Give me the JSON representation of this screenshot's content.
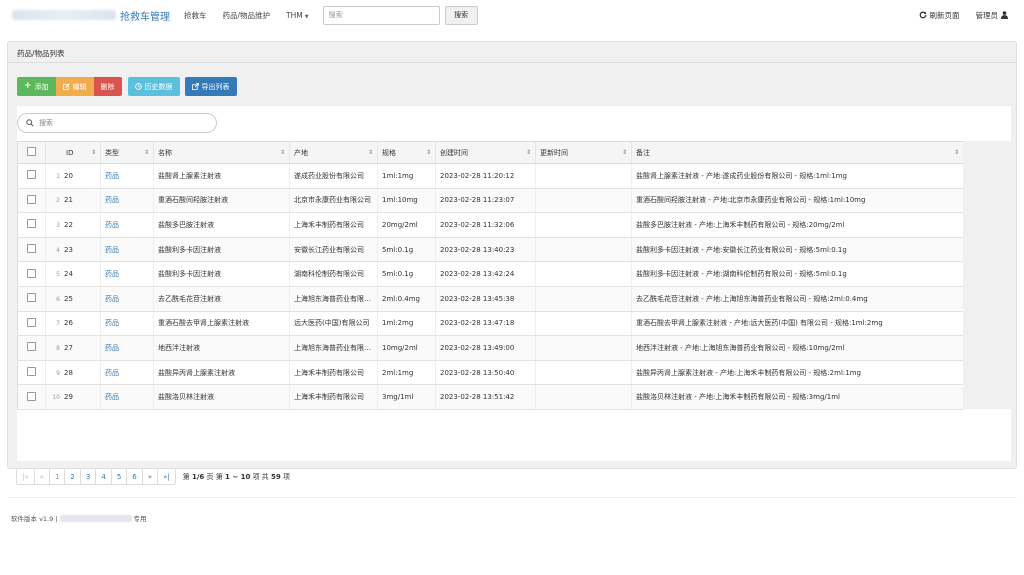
{
  "navbar": {
    "brand": "抢救车管理",
    "links": [
      "抢救车",
      "药品/物品维护",
      "THM"
    ],
    "search_placeholder": "搜索",
    "search_button": "搜索",
    "refresh": "刷新页面",
    "user": "管理员"
  },
  "panel": {
    "title": "药品/物品列表",
    "toolbar": {
      "add": "添加",
      "edit": "编辑",
      "delete": "删除",
      "history": "历史数据",
      "export": "导出列表"
    },
    "search_placeholder": "搜索"
  },
  "table": {
    "columns": [
      "ID",
      "类型",
      "名称",
      "产地",
      "规格",
      "创建时间",
      "更新时间",
      "备注"
    ],
    "rows": [
      {
        "n": "1",
        "id": "20",
        "type": "药品",
        "name": "盐酸肾上腺素注射液",
        "origin": "遂成药业股份有限公司",
        "spec": "1ml:1mg",
        "created": "2023-02-28 11:20:12",
        "updated": "",
        "note": "盐酸肾上腺素注射液 - 产地:遂成药业股份有限公司 - 规格:1ml:1mg"
      },
      {
        "n": "2",
        "id": "21",
        "type": "药品",
        "name": "重酒石酸间羟胺注射液",
        "origin": "北京市永康药业有限公司",
        "spec": "1ml:10mg",
        "created": "2023-02-28 11:23:07",
        "updated": "",
        "note": "重酒石酸间羟胺注射液 - 产地:北京市永康药业有限公司 - 规格:1ml:10mg"
      },
      {
        "n": "3",
        "id": "22",
        "type": "药品",
        "name": "盐酸多巴胺注射液",
        "origin": "上海禾丰制药有限公司",
        "spec": "20mg/2ml",
        "created": "2023-02-28 11:32:06",
        "updated": "",
        "note": "盐酸多巴胺注射液 - 产地:上海禾丰制药有限公司 - 规格:20mg/2ml"
      },
      {
        "n": "4",
        "id": "23",
        "type": "药品",
        "name": "盐酸利多卡因注射液",
        "origin": "安徽长江药业有限公司",
        "spec": "5ml:0.1g",
        "created": "2023-02-28 13:40:23",
        "updated": "",
        "note": "盐酸利多卡因注射液 - 产地:安徽长江药业有限公司 - 规格:5ml:0.1g"
      },
      {
        "n": "5",
        "id": "24",
        "type": "药品",
        "name": "盐酸利多卡因注射液",
        "origin": "湖南科伦制药有限公司",
        "spec": "5ml:0.1g",
        "created": "2023-02-28 13:42:24",
        "updated": "",
        "note": "盐酸利多卡因注射液 - 产地:湖南科伦制药有限公司 - 规格:5ml:0.1g"
      },
      {
        "n": "6",
        "id": "25",
        "type": "药品",
        "name": "去乙酰毛花苷注射液",
        "origin": "上海旭东海普药业有限公司",
        "spec": "2ml:0.4mg",
        "created": "2023-02-28 13:45:38",
        "updated": "",
        "note": "去乙酰毛花苷注射液 - 产地:上海旭东海普药业有限公司 - 规格:2ml:0.4mg"
      },
      {
        "n": "7",
        "id": "26",
        "type": "药品",
        "name": "重酒石酸去甲肾上腺素注射液",
        "origin": "远大医药(中国)有限公司",
        "spec": "1ml:2mg",
        "created": "2023-02-28 13:47:18",
        "updated": "",
        "note": "重酒石酸去甲肾上腺素注射液 - 产地:远大医药(中国) 有限公司 - 规格:1ml:2mg"
      },
      {
        "n": "8",
        "id": "27",
        "type": "药品",
        "name": "地西泮注射液",
        "origin": "上海旭东海普药业有限公司",
        "spec": "10mg/2ml",
        "created": "2023-02-28 13:49:00",
        "updated": "",
        "note": "地西泮注射液 - 产地:上海旭东海普药业有限公司 - 规格:10mg/2ml"
      },
      {
        "n": "9",
        "id": "28",
        "type": "药品",
        "name": "盐酸异丙肾上腺素注射液",
        "origin": "上海禾丰制药有限公司",
        "spec": "2ml:1mg",
        "created": "2023-02-28 13:50:40",
        "updated": "",
        "note": "盐酸异丙肾上腺素注射液 - 产地:上海禾丰制药有限公司 - 规格:2ml:1mg"
      },
      {
        "n": "10",
        "id": "29",
        "type": "药品",
        "name": "盐酸洛贝林注射液",
        "origin": "上海禾丰制药有限公司",
        "spec": "3mg/1ml",
        "created": "2023-02-28 13:51:42",
        "updated": "",
        "note": "盐酸洛贝林注射液 - 产地:上海禾丰制药有限公司 - 规格:3mg/1ml"
      }
    ]
  },
  "pagination": {
    "first": "|«",
    "prev_page": "«",
    "pages": [
      "1",
      "2",
      "3",
      "4",
      "5",
      "6"
    ],
    "next_page": "»",
    "last": "»|",
    "page_label_prefix": "第",
    "current_page": "1/6",
    "page_label_suffix": "页",
    "range_prefix": "第",
    "range": "1 ~ 10",
    "range_suffix": "项",
    "total_prefix": "共",
    "total": "59",
    "total_suffix": "项"
  },
  "footer": {
    "version": "软件版本 v1.9 | ",
    "suffix": "专用"
  }
}
